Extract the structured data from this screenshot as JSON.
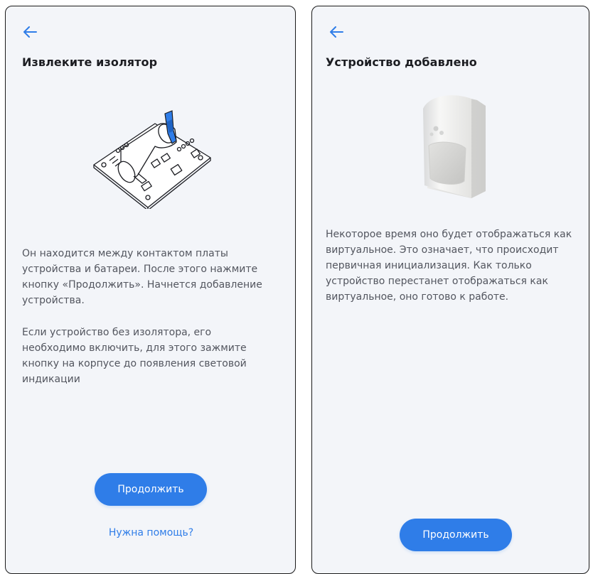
{
  "left_screen": {
    "title": "Извлеките изолятор",
    "paragraph_1": "Он находится между контактом платы устройства и батареи. После этого нажмите кнопку «Продолжить». Начнется добавление устройства.",
    "paragraph_2": "Если устройство без изолятора, его необходимо включить, для этого зажмите кнопку на корпусе до появления световой индикации",
    "continue_label": "Продолжить",
    "help_label": "Нужна помощь?"
  },
  "right_screen": {
    "title": "Устройство добавлено",
    "paragraph_1": "Некоторое время оно будет отображаться как виртуальное. Это означает, что происходит первичная инициализация. Как только устройство перестанет отображаться как виртуальное, оно готово к работе.",
    "continue_label": "Продолжить"
  },
  "colors": {
    "accent": "#2f7de8",
    "background": "#f3f5f9",
    "title_text": "#1c1d22",
    "body_text": "#53565f"
  },
  "icons": {
    "back": "arrow-left-icon",
    "board_illustration": "circuit-board-insulator-illustration",
    "sensor_image": "motion-sensor-image"
  }
}
